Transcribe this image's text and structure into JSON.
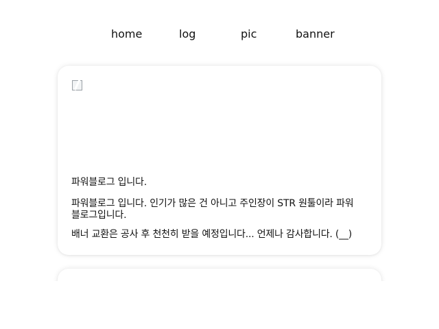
{
  "nav": {
    "items": [
      {
        "label": "home"
      },
      {
        "label": "log"
      },
      {
        "label": "pic"
      },
      {
        "label": "banner"
      }
    ]
  },
  "post": {
    "image_state": "broken-image",
    "title": "파워블로그 입니다.",
    "description": "파워블로그 입니다. 인기가 많은 건 아니고 주인장이 STR 원툴이라 파워블로그입니다.",
    "note": "배너 교환은 공사 후 천천히 받을 예정입니다... 언제나 감사합니다. (__)"
  }
}
